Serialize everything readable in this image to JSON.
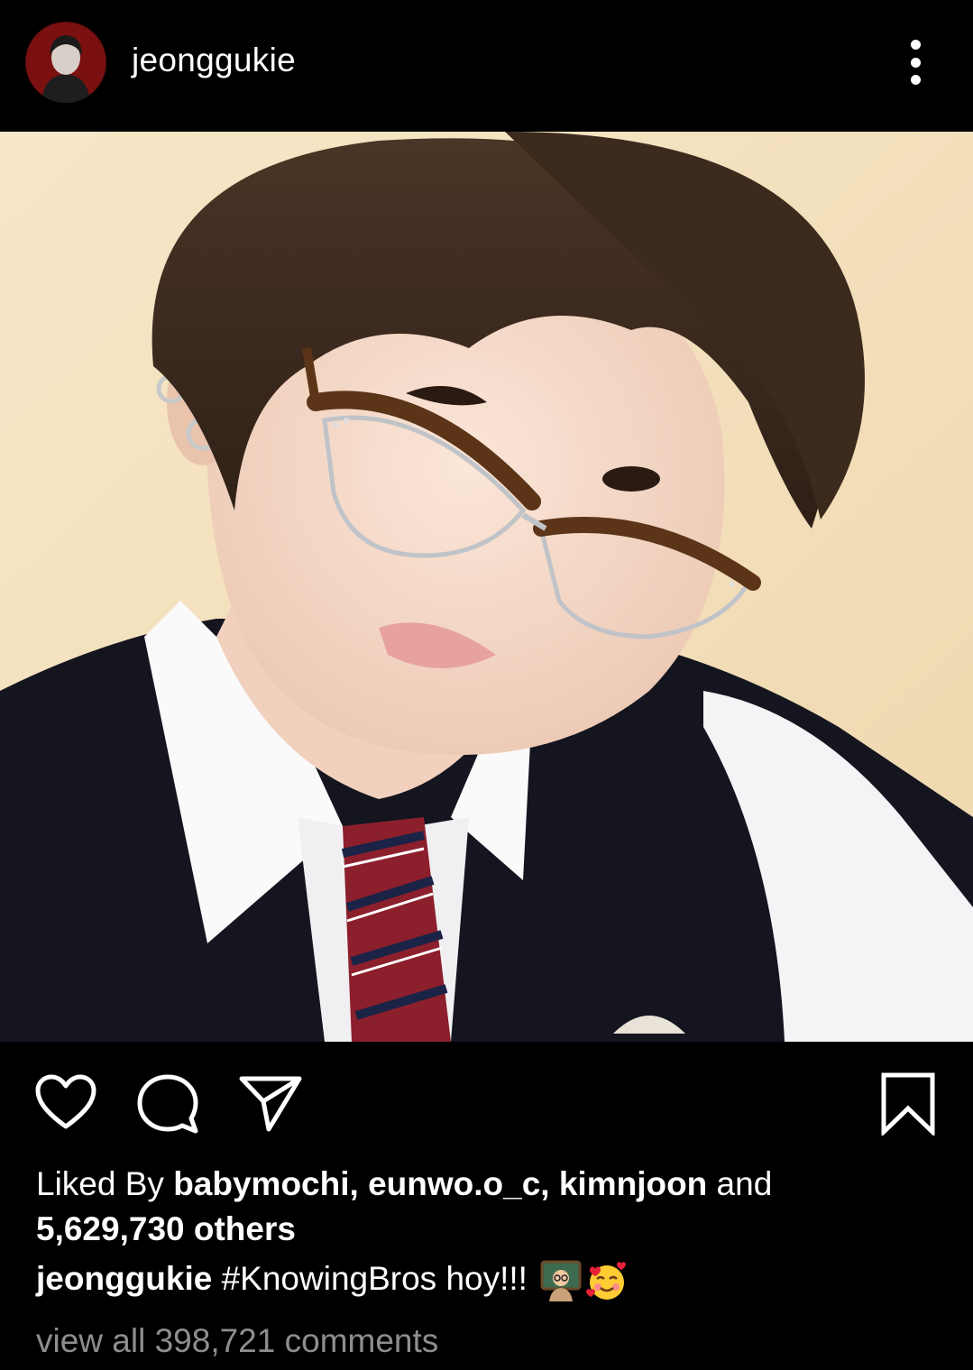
{
  "header": {
    "username": "jeonggukie",
    "avatar_icon": "profile-avatar",
    "more_icon": "more-vertical-icon"
  },
  "post": {
    "image_description_icon": "selfie-photo"
  },
  "actions": {
    "like_icon": "heart-icon",
    "comment_icon": "comment-bubble-icon",
    "share_icon": "paper-plane-icon",
    "save_icon": "bookmark-icon"
  },
  "likes": {
    "prefix": "Liked By ",
    "users": "babymochi, eunwo.o_c, kimnjoon",
    "connector": " and",
    "count_text": "5,629,730 others"
  },
  "caption": {
    "username": "jeonggukie",
    "text": " #KnowingBros hoy!!! "
  },
  "comments": {
    "view_all": "view all 398,721 comments"
  },
  "colors": {
    "background": "#000000",
    "text": "#ffffff",
    "muted": "#8e8e8e"
  }
}
